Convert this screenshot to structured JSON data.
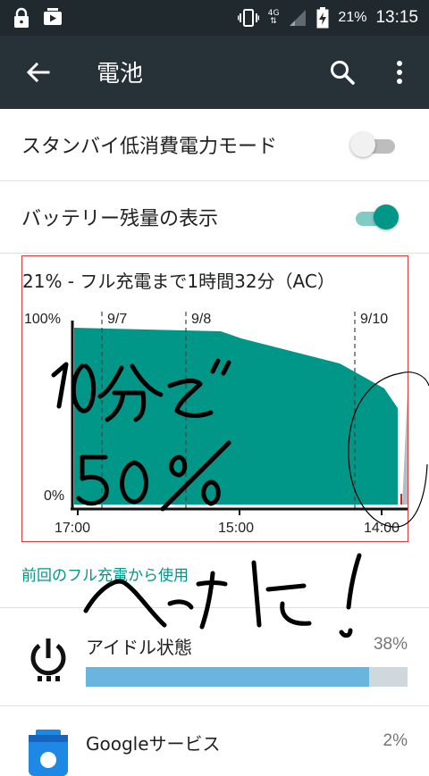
{
  "status_bar": {
    "left_icons": [
      "lock-icon",
      "media-notification-icon"
    ],
    "network": "4G",
    "battery_percent": "21%",
    "time": "13:15"
  },
  "toolbar": {
    "title": "電池",
    "icons": [
      "back-arrow-icon",
      "search-icon",
      "more-vert-icon"
    ]
  },
  "settings": {
    "standby_mode": {
      "label": "スタンバイ低消費電力モード",
      "enabled": false
    },
    "show_battery_level": {
      "label": "バッテリー残量の表示",
      "enabled": true
    }
  },
  "battery_chart": {
    "title": "21% - フル充電まで1時間32分（AC）",
    "y_top_label": "100%",
    "y_bottom_label": "0%",
    "date_markers": [
      "9/7",
      "9/8",
      "9/10"
    ],
    "x_labels": [
      "17:00",
      "15:00",
      "14:00"
    ],
    "fill_color": "#009688"
  },
  "handwriting": {
    "lines": [
      "10分で",
      "50%",
      "へった!"
    ]
  },
  "usage_section": {
    "header": "前回のフル充電から使用",
    "items": [
      {
        "name": "アイドル状態",
        "percent": "38%",
        "fraction": 0.88,
        "icon": "power-icon"
      },
      {
        "name": "Googleサービス",
        "percent": "2%",
        "icon": "google-services-icon"
      }
    ]
  },
  "colors": {
    "accent": "#009688",
    "toolbar": "#263238",
    "statusbar": "#1f292e",
    "usage_bar": "#6ab4e0"
  }
}
